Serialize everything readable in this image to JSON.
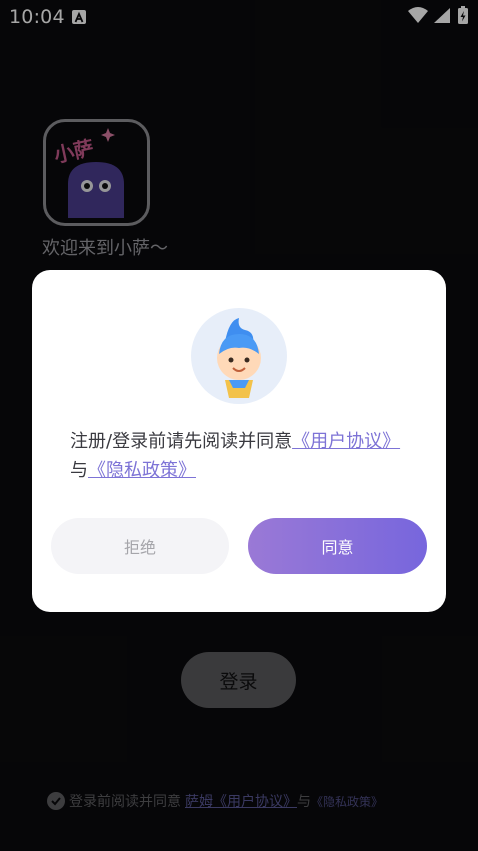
{
  "status_bar": {
    "time": "10:04",
    "icons": [
      "notification-a-icon",
      "wifi-icon",
      "signal-icon",
      "battery-icon"
    ]
  },
  "app": {
    "logo_text": "小萨",
    "welcome": "欢迎来到小萨～",
    "login_label": "登录"
  },
  "bottom_agreement": {
    "prefix": "登录前阅读并同意",
    "user_agreement": "萨姆《用户协议》",
    "conjunction": "与",
    "privacy_policy": "《隐私政策》"
  },
  "dialog": {
    "message_prefix": "注册/登录前请先阅读并同意",
    "user_agreement": "《用户协议》",
    "conjunction": "与",
    "privacy_policy": "《隐私政策》",
    "reject_label": "拒绝",
    "agree_label": "同意"
  },
  "colors": {
    "background": "#0a0a0d",
    "accent_start": "#9a79d6",
    "accent_end": "#7766dd",
    "link": "#7d73d6"
  }
}
